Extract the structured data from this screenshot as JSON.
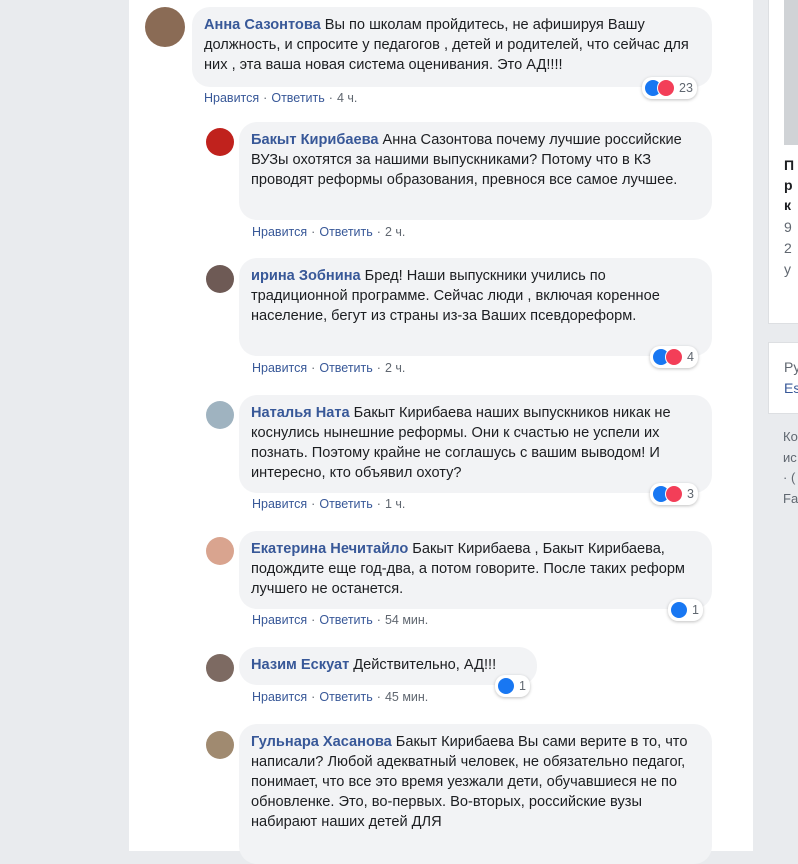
{
  "comments": [
    {
      "author": "Анна Сазонтова",
      "text": "Вы по школам пройдитесь, не афишируя Вашу должность, и спросите у педагогов , детей и родителей, что сейчас для них , эта ваша новая система оценивания. Это АД!!!!",
      "like": "Нравится",
      "reply": "Ответить",
      "time": "4 ч.",
      "reactions": "23",
      "avatar_color": "#8a6b55"
    },
    {
      "author": "Бакыт Кирибаева",
      "text": "Анна Сазонтова почему лучшие российские ВУЗы охотятся за нашими выпускниками? Потому что в КЗ проводят реформы образования, превнося все самое лучшее.",
      "like": "Нравится",
      "reply": "Ответить",
      "time": "2 ч.",
      "avatar_color": "#c0221d"
    },
    {
      "author": "ирина Зобнина",
      "text": "Бред! Наши выпускники учились по традиционной программе. Сейчас люди , включая коренное население, бегут из страны из-за Ваших псевдореформ.",
      "like": "Нравится",
      "reply": "Ответить",
      "time": "2 ч.",
      "reactions": "4",
      "avatar_color": "#6e5a55"
    },
    {
      "author": "Наталья Ната",
      "text": "Бакыт Кирибаева наших выпускников никак не коснулись нынешние реформы. Они к счастью не успели их познать. Поэтому крайне не соглашусь с вашим выводом! И интересно, кто объявил охоту?",
      "like": "Нравится",
      "reply": "Ответить",
      "time": "1 ч.",
      "reactions": "3",
      "avatar_color": "#9fb3c0"
    },
    {
      "author": "Екатерина Нечитайло",
      "text": "Бакыт Кирибаева , Бакыт Кирибаева, подождите еще год-два, а потом говорите. После таких реформ лучшего не останется.",
      "like": "Нравится",
      "reply": "Ответить",
      "time": "54 мин.",
      "reactions": "1",
      "avatar_color": "#d9a48f"
    },
    {
      "author": "Назим Ескуат",
      "text": "Действительно, АД!!!",
      "like": "Нравится",
      "reply": "Ответить",
      "time": "45 мин.",
      "reactions": "1",
      "avatar_color": "#7d6a62"
    },
    {
      "author": "Гульнара Хасанова",
      "text": "Бакыт Кирибаева Вы сами верите в то, что написали? Любой адекватный человек, не обязательно педагог, понимает, что все это время уезжали дети, обучавшиеся не по обновленке. Это, во-первых. Во-вторых, российские вузы набирают наших детей ДЛЯ",
      "avatar_color": "#a08a70"
    }
  ],
  "right_panel": {
    "snippets": [
      "П",
      "р",
      "к",
      "9",
      "2",
      "у",
      "Ру",
      "Es",
      "Ко",
      "ис",
      "· (",
      "Fa"
    ]
  }
}
